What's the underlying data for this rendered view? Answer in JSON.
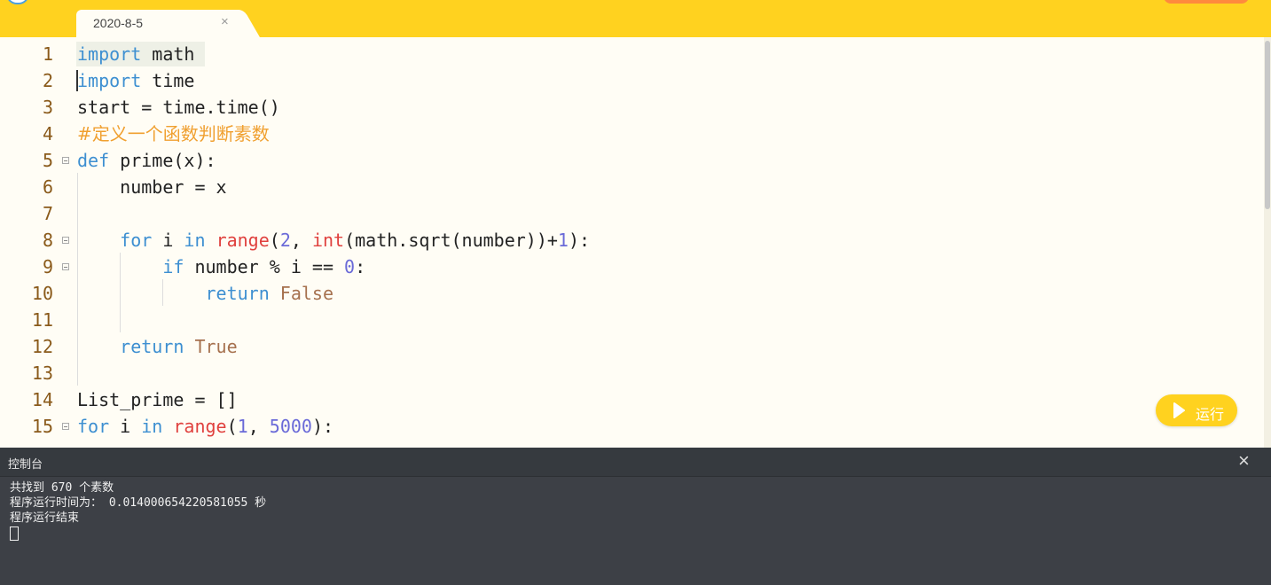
{
  "tab": {
    "title": "2020-8-5",
    "close": "×"
  },
  "editor": {
    "line_numbers": [
      "1",
      "2",
      "3",
      "4",
      "5",
      "6",
      "7",
      "8",
      "9",
      "10",
      "11",
      "12",
      "13",
      "14",
      "15"
    ],
    "lines": {
      "l1": [
        "import",
        " math"
      ],
      "l2": [
        "import",
        " time"
      ],
      "l3": [
        "start = time.time()"
      ],
      "l4": [
        "#定义一个函数判断素数"
      ],
      "l5": [
        "def",
        " prime(x):"
      ],
      "l6": [
        "    number = x"
      ],
      "l8": [
        "    ",
        "for",
        " i ",
        "in",
        " ",
        "range",
        "(",
        "2",
        ", ",
        "int",
        "(math.sqrt(number))+",
        "1",
        "):"
      ],
      "l9": [
        "        ",
        "if",
        " number % i == ",
        "0",
        ":"
      ],
      "l10": [
        "            ",
        "return",
        " ",
        "False"
      ],
      "l12": [
        "    ",
        "return",
        " ",
        "True"
      ],
      "l14": [
        "List_prime = []"
      ],
      "l15": [
        "for",
        " i ",
        "in",
        " ",
        "range",
        "(",
        "1",
        ", ",
        "5000",
        "):"
      ]
    }
  },
  "run_button": {
    "label": "运行"
  },
  "console": {
    "title": "控制台",
    "close": "×",
    "output": [
      "共找到 670 个素数",
      "程序运行时间为： 0.014000654220581055 秒",
      "程序运行结束"
    ]
  },
  "colors": {
    "topbar": "#ffd21f",
    "keyword": "#3d8fd1",
    "builtin": "#e0413e",
    "number": "#6a6ad8",
    "comment": "#f0a030"
  }
}
